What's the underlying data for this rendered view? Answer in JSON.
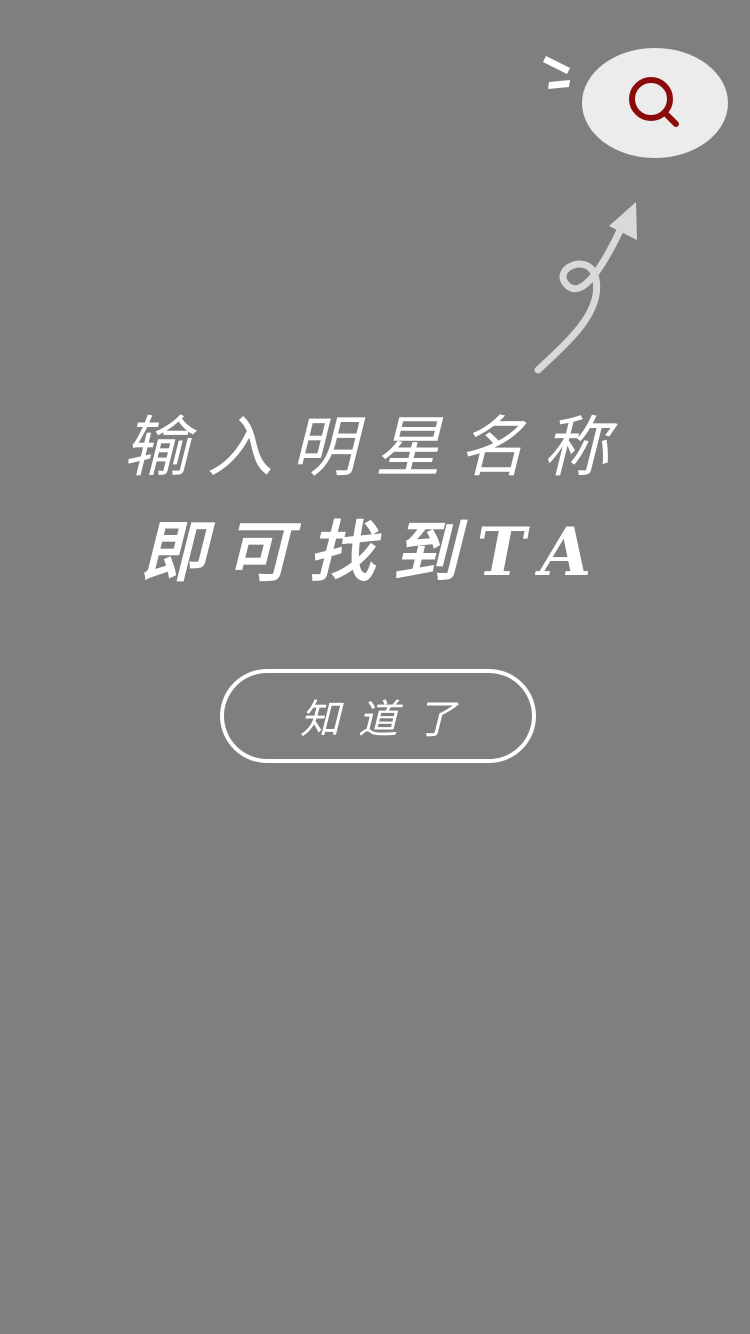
{
  "search_button": {
    "icon": "search-icon",
    "color": "#8b0a0a"
  },
  "guide": {
    "line1": "输入明星名称",
    "line2": "即可找到TA"
  },
  "ok_button": {
    "label": "知道了"
  },
  "colors": {
    "overlay": "#7f7f7f",
    "bubble": "#ececec",
    "text": "#ffffff"
  }
}
